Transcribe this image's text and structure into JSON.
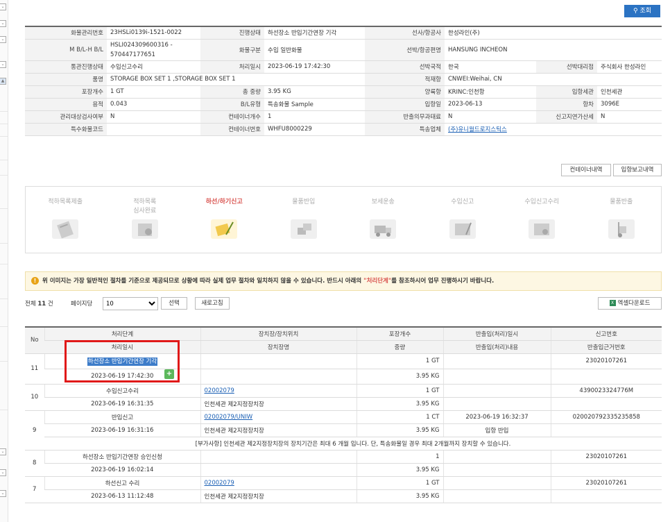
{
  "search_button": "조회",
  "info": {
    "rows": [
      [
        [
          "화물관리번호",
          "23HSLi0139i-1521-0022"
        ],
        [
          "진행상태",
          "하선장소 반입기간연장 기각"
        ],
        [
          "선사/항공사",
          "한성라인(주)"
        ]
      ],
      [
        [
          "M B/L-H B/L",
          "HSLI024309600316 - 570447177651"
        ],
        [
          "화물구분",
          "수입 일반화물"
        ],
        [
          "선박/항공편명",
          "HANSUNG INCHEON"
        ]
      ],
      [
        [
          "통관진행상태",
          "수입신고수리"
        ],
        [
          "처리일시",
          "2023-06-19 17:42:30"
        ],
        [
          "선박국적",
          "한국"
        ],
        [
          "선박대리점",
          "주식회사 한성라인"
        ]
      ],
      [
        [
          "품명",
          "STORAGE BOX SET 1 ,STORAGE BOX SET 1"
        ],
        [
          "적재항",
          "CNWEI:Weihai, CN"
        ]
      ],
      [
        [
          "포장개수",
          "1 GT"
        ],
        [
          "총 중량",
          "3.95 KG"
        ],
        [
          "양륙항",
          "KRINC:인천항"
        ],
        [
          "입항세관",
          "인천세관"
        ]
      ],
      [
        [
          "용적",
          "0.043"
        ],
        [
          "B/L유형",
          "특송화물 Sample"
        ],
        [
          "입항일",
          "2023-06-13"
        ],
        [
          "항차",
          "3096E"
        ]
      ],
      [
        [
          "관리대상검사여부",
          "N"
        ],
        [
          "컨테이너개수",
          "1"
        ],
        [
          "반출의무과태료",
          "N"
        ],
        [
          "신고지연가산세",
          "N"
        ]
      ],
      [
        [
          "특수화물코드",
          ""
        ],
        [
          "컨테이너번호",
          "WHFU8000229"
        ],
        [
          "특송업체",
          "(주)유니월드로지스틱스"
        ]
      ]
    ]
  },
  "buttons": {
    "container": "컨테이너내역",
    "arrival": "입항보고내역",
    "refresh": "새로고침",
    "select": "선택",
    "excel": "엑셀다운로드"
  },
  "steps": [
    "적하목록제출",
    "적하목록\n심사완료",
    "하선/하기신고",
    "물품반입",
    "보세운송",
    "수입신고",
    "수입신고수리",
    "물품반출"
  ],
  "notice": {
    "before": "위 이미지는 가장 일반적인 절차를 기준으로 제공되므로 상황에 따라 실제 업무 절차와 일치하지 않을 수 있습니다. 반드시 아래의 ",
    "emph": "\"처리단계\"",
    "after": "를 참조하시어 업무 진행하시기 바랍니다."
  },
  "list": {
    "total_label": "전체",
    "total": "11",
    "unit": "건",
    "per_page_label": "페이지당",
    "per_page": "10"
  },
  "headers": {
    "row1": [
      "No",
      "처리단계",
      "장치장/장치위치",
      "포장개수",
      "반출입(처리)일시",
      "신고번호"
    ],
    "row2": [
      "처리일시",
      "장치장명",
      "중량",
      "반출입(처리)내용",
      "반출입근거번호"
    ]
  },
  "records": [
    {
      "no": "11",
      "step": "하선장소 반입기간연장 기각",
      "date": "2023-06-19 17:42:30",
      "loc": "",
      "locname": "",
      "pkg": "1 GT",
      "weight": "3.95 KG",
      "io_date": "",
      "io_content": "",
      "report": "23020107261",
      "basis": ""
    },
    {
      "no": "10",
      "step": "수입신고수리",
      "date": "2023-06-19 16:31:35",
      "loc": "02002079",
      "locname": "인천세관 제2지정장치장",
      "pkg": "1 GT",
      "weight": "3.95 KG",
      "io_date": "",
      "io_content": "",
      "report": "4390023324776M",
      "basis": ""
    },
    {
      "no": "9",
      "step": "반입신고",
      "date": "2023-06-19 16:31:16",
      "loc": "02002079/UNIW",
      "locname": "인천세관 제2지정장치장",
      "pkg": "1 CT",
      "weight": "3.95 KG",
      "io_date": "2023-06-19 16:32:37",
      "io_content": "입항 반입",
      "report": "020020792335235858",
      "basis": "",
      "note": "[부가사항] 인천세관 제2지정장치장의 장치기간은 최대 6 개월 입니다. 단, 특송화물일 경우 최대 2개월까지 장치할 수 있습니다."
    },
    {
      "no": "8",
      "step": "하선장소 반입기간연장 승인신청",
      "date": "2023-06-19 16:02:14",
      "loc": "",
      "locname": "",
      "pkg": "1",
      "weight": "3.95 KG",
      "io_date": "",
      "io_content": "",
      "report": "23020107261",
      "basis": ""
    },
    {
      "no": "7",
      "step": "하선신고 수리",
      "date": "2023-06-13 11:12:48",
      "loc": "02002079",
      "locname": "인천세관 제2지정장치장",
      "pkg": "1 GT",
      "weight": "3.95 KG",
      "io_date": "",
      "io_content": "",
      "report": "23020107261",
      "basis": ""
    }
  ]
}
